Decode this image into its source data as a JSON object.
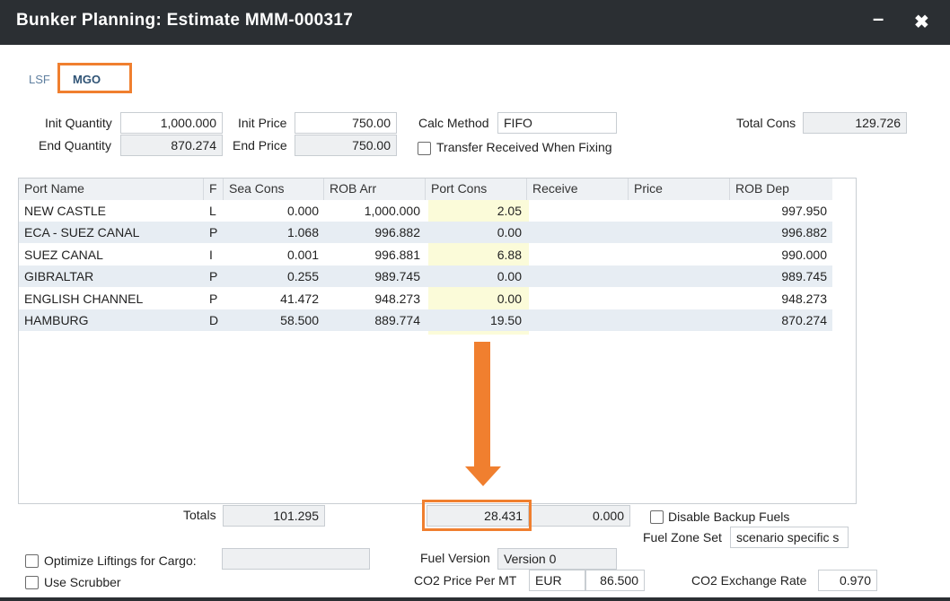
{
  "window": {
    "title": "Bunker Planning: Estimate MMM-000317",
    "minimize_glyph": "–",
    "close_glyph": "✖"
  },
  "tabs": [
    {
      "label": "LSF"
    },
    {
      "label": "MGO",
      "selected": true
    }
  ],
  "params": {
    "init_quantity_label": "Init Quantity",
    "init_quantity": "1,000.000",
    "end_quantity_label": "End Quantity",
    "end_quantity": "870.274",
    "init_price_label": "Init Price",
    "init_price": "750.00",
    "end_price_label": "End Price",
    "end_price": "750.00",
    "calc_method_label": "Calc Method",
    "calc_method": "FIFO",
    "transfer_label": "Transfer Received When Fixing",
    "total_cons_label": "Total Cons",
    "total_cons": "129.726"
  },
  "grid": {
    "columns": [
      "Port Name",
      "F",
      "Sea Cons",
      "ROB Arr",
      "Port Cons",
      "Receive",
      "Price",
      "ROB Dep"
    ],
    "rows": [
      {
        "port": "NEW CASTLE",
        "f": "L",
        "sea": "0.000",
        "rob_arr": "1,000.000",
        "port_cons": "2.05",
        "receive": "",
        "price": "",
        "rob_dep": "997.950"
      },
      {
        "port": "ECA - SUEZ CANAL",
        "f": "P",
        "sea": "1.068",
        "rob_arr": "996.882",
        "port_cons": "0.00",
        "receive": "",
        "price": "",
        "rob_dep": "996.882"
      },
      {
        "port": "SUEZ CANAL",
        "f": "I",
        "sea": "0.001",
        "rob_arr": "996.881",
        "port_cons": "6.88",
        "receive": "",
        "price": "",
        "rob_dep": "990.000"
      },
      {
        "port": "GIBRALTAR",
        "f": "P",
        "sea": "0.255",
        "rob_arr": "989.745",
        "port_cons": "0.00",
        "receive": "",
        "price": "",
        "rob_dep": "989.745"
      },
      {
        "port": "ENGLISH CHANNEL",
        "f": "P",
        "sea": "41.472",
        "rob_arr": "948.273",
        "port_cons": "0.00",
        "receive": "",
        "price": "",
        "rob_dep": "948.273"
      },
      {
        "port": "HAMBURG",
        "f": "D",
        "sea": "58.500",
        "rob_arr": "889.774",
        "port_cons": "19.50",
        "receive": "",
        "price": "",
        "rob_dep": "870.274"
      }
    ]
  },
  "totals": {
    "label": "Totals",
    "sea_cons": "101.295",
    "port_cons": "28.431",
    "receive": "0.000",
    "disable_backup_label": "Disable Backup Fuels",
    "fuel_zone_set_label": "Fuel Zone Set",
    "fuel_zone_set": "scenario specific s"
  },
  "footer": {
    "optimize_label": "Optimize Liftings for Cargo:",
    "optimize_value": "",
    "scrubber_label": "Use Scrubber",
    "fuel_version_label": "Fuel Version",
    "fuel_version": "Version 0",
    "co2_price_label": "CO2 Price Per MT",
    "co2_currency": "EUR",
    "co2_price": "86.500",
    "co2_rate_label": "CO2 Exchange Rate",
    "co2_rate": "0.970"
  },
  "colors": {
    "accent": "#f07f2f",
    "titlebar": "#2b2f33",
    "port_cons_highlight": "#fbfbd9",
    "alt_row": "#e7edf3"
  }
}
